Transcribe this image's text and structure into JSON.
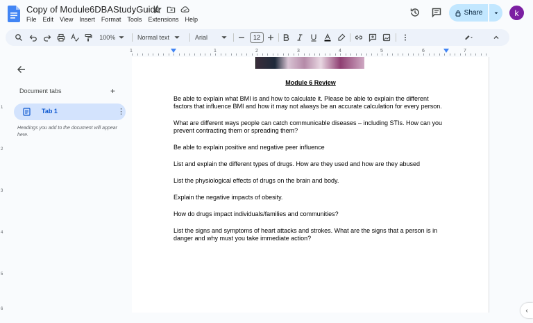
{
  "app": {
    "title": "Copy of Module6DBAStudyGuide",
    "menu": [
      "File",
      "Edit",
      "View",
      "Insert",
      "Format",
      "Tools",
      "Extensions",
      "Help"
    ],
    "share_label": "Share",
    "avatar_letter": "k"
  },
  "toolbar": {
    "zoom": "100%",
    "style": "Normal text",
    "font": "Arial",
    "font_size": "12"
  },
  "ruler": {
    "numbers": [
      "1",
      "1",
      "2",
      "3",
      "4",
      "5",
      "6",
      "7"
    ]
  },
  "vruler": {
    "numbers": [
      "1",
      "2",
      "3",
      "4",
      "5",
      "6"
    ]
  },
  "sidebar": {
    "section_label": "Document tabs",
    "tab_label": "Tab 1",
    "hint": "Headings you add to the document will appear here."
  },
  "document": {
    "heading": "Module 6 Review",
    "paragraphs": [
      "Be able to explain what BMI is and how to calculate it.  Please be able to explain the different factors that influence BMI and how it may not always be an accurate calculation for every person.",
      "What are different ways people can catch communicable diseases – including STIs. How can you prevent contracting them or spreading them?",
      "Be able to explain positive and negative peer influence",
      "List and explain the different types of drugs.  How are they used and how are they abused",
      "List the physiological effects of drugs on the brain and body.",
      "Explain the negative impacts of obesity.",
      "How do drugs impact individuals/families and communities?",
      "List the signs and symptoms of heart attacks and strokes.  What are the signs that a person is in danger and why must you take immediate action?"
    ]
  },
  "colors": {
    "accent": "#0b57d0",
    "share_bg": "#c2e7ff",
    "toolbar_bg": "#edf2fa",
    "tab_bg": "#d3e3fd",
    "avatar_bg": "#7b1fa2"
  }
}
